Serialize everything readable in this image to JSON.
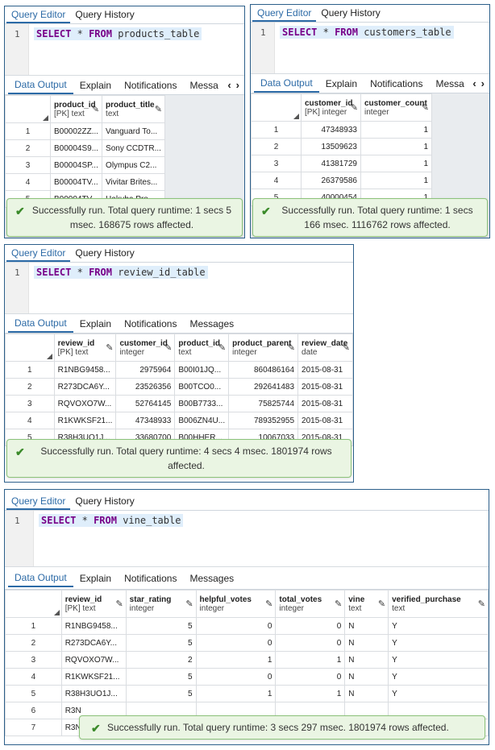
{
  "panels": [
    {
      "query_tabs": [
        "Query Editor",
        "Query History"
      ],
      "line_number": "1",
      "sql": {
        "kw1": "SELECT",
        "star": "*",
        "kw2": "FROM",
        "table": "products_table"
      },
      "output_tabs": [
        "Data Output",
        "Explain",
        "Notifications",
        "Messa"
      ],
      "columns": [
        {
          "name": "product_id",
          "type": "[PK] text"
        },
        {
          "name": "product_title",
          "type": "text"
        }
      ],
      "rows": [
        [
          "1",
          "B00002ZZ...",
          "Vanguard To..."
        ],
        [
          "2",
          "B00004S9...",
          "Sony CCDTR..."
        ],
        [
          "3",
          "B00004SP...",
          "Olympus C2..."
        ],
        [
          "4",
          "B00004TV...",
          "Vivitar Brites..."
        ],
        [
          "5",
          "B00004TV...",
          "Hakuba Pro..."
        ]
      ],
      "toast": "Successfully run. Total query runtime: 1 secs 5 msec. 168675 rows affected."
    },
    {
      "query_tabs": [
        "Query Editor",
        "Query History"
      ],
      "line_number": "1",
      "sql": {
        "kw1": "SELECT",
        "star": "*",
        "kw2": "FROM",
        "table": "customers_table"
      },
      "output_tabs": [
        "Data Output",
        "Explain",
        "Notifications",
        "Messa"
      ],
      "columns": [
        {
          "name": "customer_id",
          "type": "[PK] integer"
        },
        {
          "name": "customer_count",
          "type": "integer"
        }
      ],
      "rows": [
        [
          "1",
          "47348933",
          "1"
        ],
        [
          "2",
          "13509623",
          "1"
        ],
        [
          "3",
          "41381729",
          "1"
        ],
        [
          "4",
          "26379586",
          "1"
        ],
        [
          "5",
          "40000454",
          "1"
        ]
      ],
      "toast": "Successfully run. Total query runtime: 1 secs 166 msec. 1116762 rows affected."
    },
    {
      "query_tabs": [
        "Query Editor",
        "Query History"
      ],
      "line_number": "1",
      "sql": {
        "kw1": "SELECT",
        "star": "*",
        "kw2": "FROM",
        "table": "review_id_table"
      },
      "output_tabs": [
        "Data Output",
        "Explain",
        "Notifications",
        "Messages"
      ],
      "columns": [
        {
          "name": "review_id",
          "type": "[PK] text"
        },
        {
          "name": "customer_id",
          "type": "integer"
        },
        {
          "name": "product_id",
          "type": "text"
        },
        {
          "name": "product_parent",
          "type": "integer"
        },
        {
          "name": "review_date",
          "type": "date"
        }
      ],
      "rows": [
        [
          "1",
          "R1NBG9458...",
          "2975964",
          "B00I01JQ...",
          "860486164",
          "2015-08-31"
        ],
        [
          "2",
          "R273DCA6Y...",
          "23526356",
          "B00TCO0...",
          "292641483",
          "2015-08-31"
        ],
        [
          "3",
          "RQVOXO7W...",
          "52764145",
          "B00B7733...",
          "75825744",
          "2015-08-31"
        ],
        [
          "4",
          "R1KWKSF21...",
          "47348933",
          "B006ZN4U...",
          "789352955",
          "2015-08-31"
        ],
        [
          "5",
          "R38H3UO1J...",
          "33680700",
          "B00HHER...",
          "10067033",
          "2015-08-31"
        ]
      ],
      "toast": "Successfully run. Total query runtime: 4 secs 4 msec. 1801974 rows affected."
    },
    {
      "query_tabs": [
        "Query Editor",
        "Query History"
      ],
      "line_number": "1",
      "sql": {
        "kw1": "SELECT",
        "star": "*",
        "kw2": "FROM",
        "table": "vine_table"
      },
      "output_tabs": [
        "Data Output",
        "Explain",
        "Notifications",
        "Messages"
      ],
      "columns": [
        {
          "name": "review_id",
          "type": "[PK] text"
        },
        {
          "name": "star_rating",
          "type": "integer"
        },
        {
          "name": "helpful_votes",
          "type": "integer"
        },
        {
          "name": "total_votes",
          "type": "integer"
        },
        {
          "name": "vine",
          "type": "text"
        },
        {
          "name": "verified_purchase",
          "type": "text"
        }
      ],
      "rows": [
        [
          "1",
          "R1NBG9458...",
          "5",
          "0",
          "0",
          "N",
          "Y"
        ],
        [
          "2",
          "R273DCA6Y...",
          "5",
          "0",
          "0",
          "N",
          "Y"
        ],
        [
          "3",
          "RQVOXO7W...",
          "2",
          "1",
          "1",
          "N",
          "Y"
        ],
        [
          "4",
          "R1KWKSF21...",
          "5",
          "0",
          "0",
          "N",
          "Y"
        ],
        [
          "5",
          "R38H3UO1J...",
          "5",
          "1",
          "1",
          "N",
          "Y"
        ],
        [
          "6",
          "R3N",
          "",
          "",
          "",
          "",
          ""
        ],
        [
          "7",
          "R3N",
          "",
          "",
          "",
          "",
          ""
        ]
      ],
      "toast": "Successfully run. Total query runtime: 3 secs 297 msec. 1801974 rows affected."
    }
  ]
}
